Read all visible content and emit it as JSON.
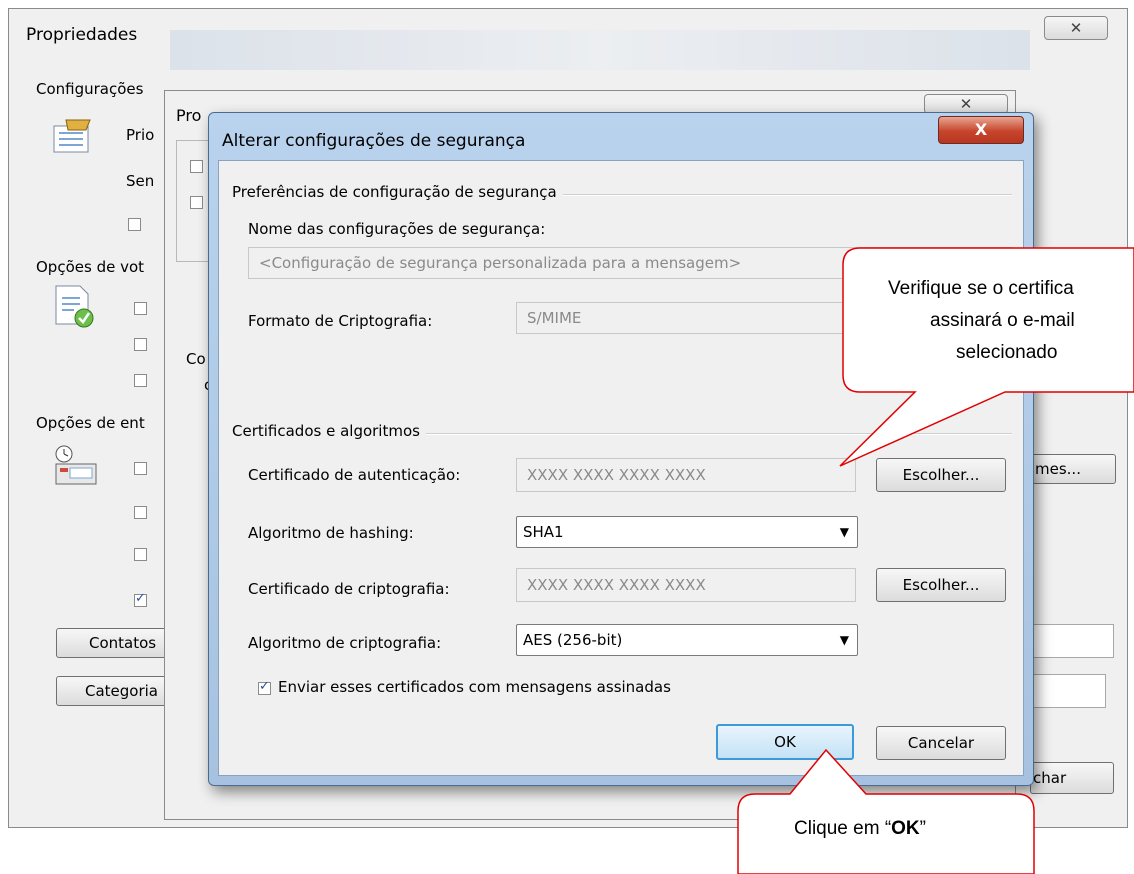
{
  "back_window": {
    "title": "Propriedades",
    "close_label": "✕",
    "section_config": "Configurações",
    "row_prio": "Prio",
    "row_sen": "Sen",
    "section_vote": "Opções de vot",
    "section_delivery": "Opções de ent",
    "btn_contacts": "Contatos",
    "btn_categories": "Categoria",
    "btn_names": "mes...",
    "btn_close": "char",
    "mid_title": "Pro",
    "mid_side_1": "Co",
    "mid_side_2": "c"
  },
  "dialog": {
    "title": "Alterar configurações de segurança",
    "close_label": "X",
    "group_prefs": "Preferências de configuração de segurança",
    "label_name": "Nome das configurações de segurança:",
    "name_value": "<Configuração de segurança personalizada para a mensagem>",
    "label_format": "Formato de Criptografia:",
    "format_value": "S/MIME",
    "group_certs": "Certificados e algoritmos",
    "label_auth_cert": "Certificado de autenticação:",
    "auth_cert_value": "XXXX XXXX XXXX XXXX",
    "btn_choose_1": "Escolher...",
    "label_hash": "Algoritmo de hashing:",
    "hash_value": "SHA1",
    "label_crypto_cert": "Certificado de criptografia:",
    "crypto_cert_value": "XXXX XXXX XXXX XXXX",
    "btn_choose_2": "Escolher...",
    "label_crypto_alg": "Algoritmo de criptografia:",
    "crypto_alg_value": "AES (256-bit)",
    "send_certs_label": "Enviar esses certificados com mensagens assinadas",
    "send_certs_checked": true,
    "btn_ok": "OK",
    "btn_cancel": "Cancelar"
  },
  "callouts": {
    "verify_line1": "Verifique se o certifica",
    "verify_line2": "assinará o e-mail",
    "verify_line3": "selecionado",
    "click_prefix": "Clique em “",
    "click_bold": "OK",
    "click_suffix": "”"
  },
  "colors": {
    "callout_border": "#e00000",
    "dialog_frame": "#b9d3ee",
    "close_red": "#c7452b"
  }
}
